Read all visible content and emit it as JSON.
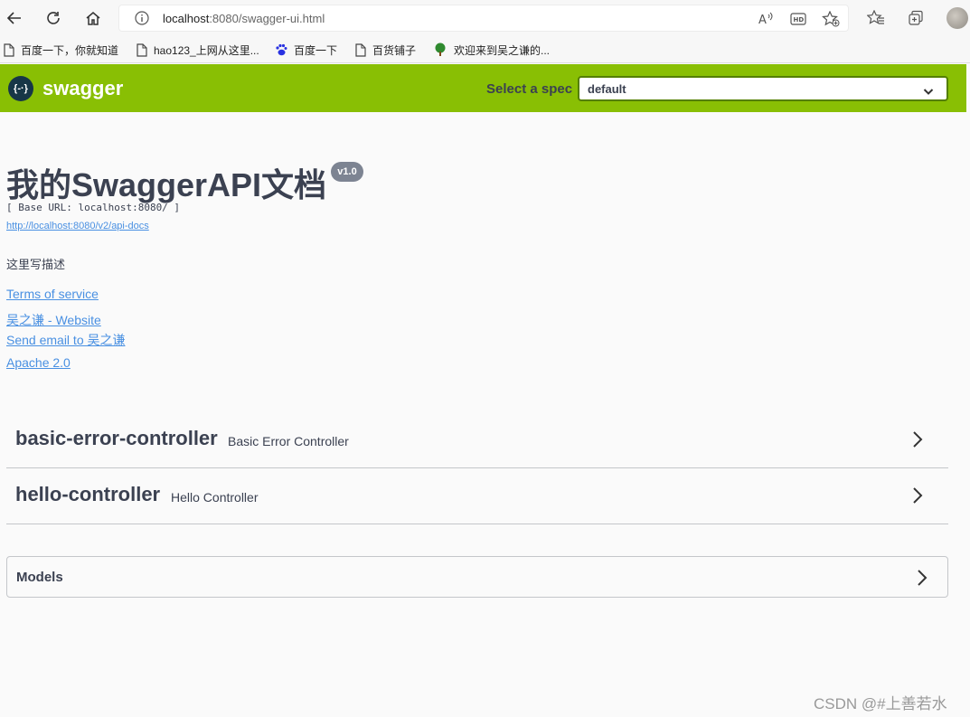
{
  "browser": {
    "url_host": "localhost",
    "url_rest": ":8080/swagger-ui.html",
    "bookmarks": [
      {
        "label": "百度一下，你就知道",
        "icon": "page-icon"
      },
      {
        "label": "hao123_上网从这里...",
        "icon": "page-icon"
      },
      {
        "label": "百度一下",
        "icon": "baidu-paw-icon"
      },
      {
        "label": "百货铺子",
        "icon": "page-icon"
      },
      {
        "label": "欢迎来到吴之谦的...",
        "icon": "tree-icon"
      }
    ]
  },
  "swagger": {
    "logo_text": "swagger",
    "logo_symbol": "{-·}",
    "spec_label": "Select a spec",
    "spec_value": "default",
    "colors": {
      "topbar": "#89bf04",
      "link": "#4990e2",
      "text": "#3b4151"
    }
  },
  "info": {
    "title": "我的SwaggerAPI文档",
    "version": "v1.0",
    "base_url": "[ Base URL: localhost:8080/ ]",
    "api_docs_link": "http://localhost:8080/v2/api-docs",
    "description": "这里写描述",
    "terms": "Terms of service",
    "website": "吴之谦 - Website",
    "email": "Send email to 吴之谦",
    "license": "Apache 2.0"
  },
  "tags": [
    {
      "name": "basic-error-controller",
      "description": "Basic Error Controller"
    },
    {
      "name": "hello-controller",
      "description": "Hello Controller"
    }
  ],
  "models_label": "Models",
  "watermark": "CSDN @#上善若水"
}
